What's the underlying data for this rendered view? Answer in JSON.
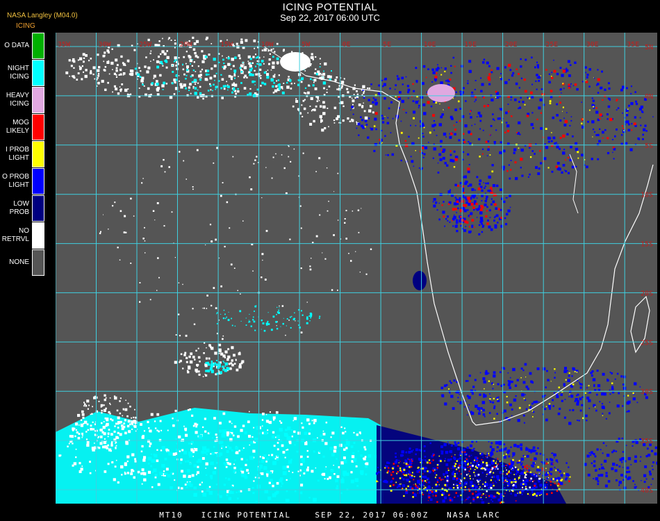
{
  "header": {
    "source": "NASA Langley (M04.0)",
    "legend_title": "ICING",
    "title": "ICING POTENTIAL",
    "subtitle": "Sep 22, 2017 06:00 UTC"
  },
  "legend": [
    {
      "lines": [
        "O DATA"
      ],
      "color": "#00b000"
    },
    {
      "lines": [
        "NIGHT",
        "ICING"
      ],
      "color": "#00ffff"
    },
    {
      "lines": [
        "HEAVY",
        "ICING"
      ],
      "color": "#e0a8e0"
    },
    {
      "lines": [
        "MOG",
        "LIKELY"
      ],
      "color": "#ff0000"
    },
    {
      "lines": [
        "I PROB",
        "LIGHT"
      ],
      "color": "#ffff00"
    },
    {
      "lines": [
        "O PROB",
        "LIGHT"
      ],
      "color": "#0000ff"
    },
    {
      "lines": [
        "LOW",
        "PROB"
      ],
      "color": "#000080"
    },
    {
      "lines": [
        "NO",
        "RETRVL"
      ],
      "color": "#ffffff"
    },
    {
      "lines": [
        "NONE"
      ],
      "color": "#555555"
    }
  ],
  "map": {
    "background_color": "#555555",
    "grid_color": "#3fd0e0",
    "coast_color": "#ffffff",
    "top_labels": [
      "35W",
      "30W",
      "25W",
      "20W",
      "15W",
      "10W",
      "5W",
      "0E",
      "5E",
      "10E",
      "15E",
      "20E",
      "25E",
      "30E",
      "35E"
    ],
    "right_labels": [
      "5N",
      "0N",
      "5S",
      "10S",
      "15S",
      "20S",
      "25S",
      "30S",
      "35S",
      "40S"
    ],
    "label_color": "#c02020"
  },
  "footer": "MT10   ICING POTENTIAL    SEP 22, 2017 06:00Z   NASA LARC"
}
